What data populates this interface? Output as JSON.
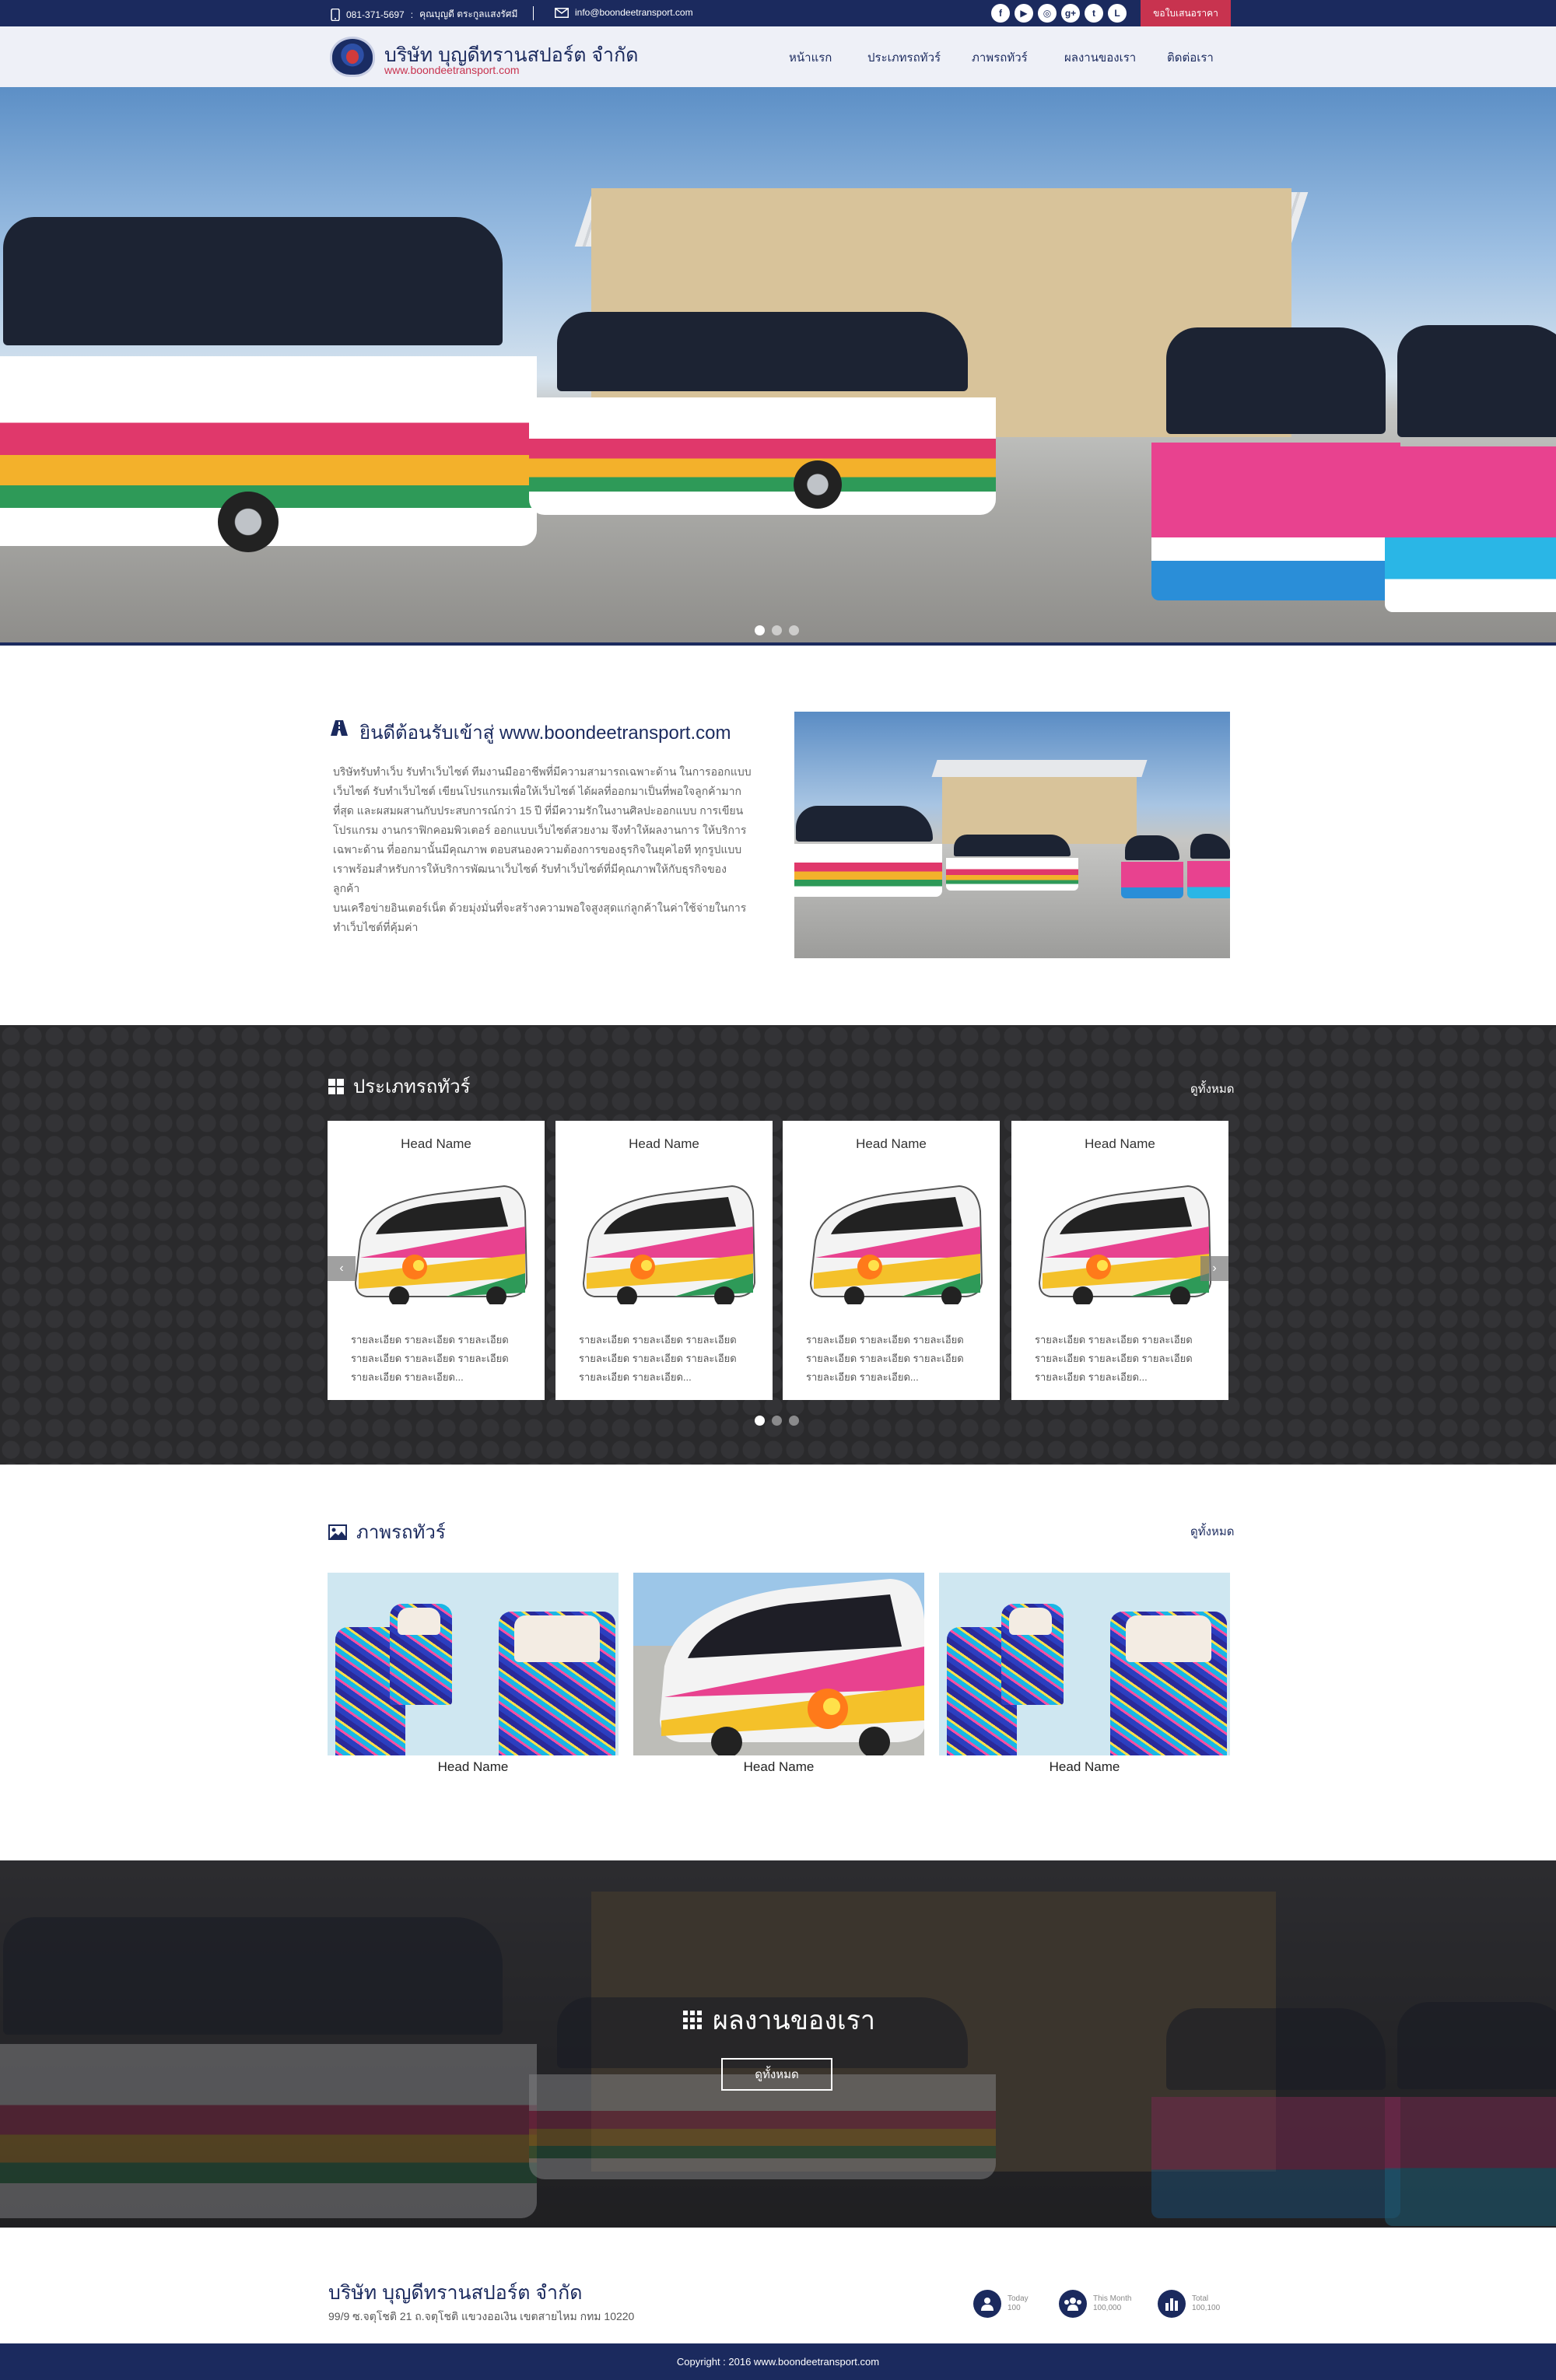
{
  "topbar": {
    "phone": "081-371-5697",
    "contact_name": "คุณบุญดี ตระกูลแสงรัศมี",
    "email": "info@boondeetransport.com",
    "quote_label": "ขอใบเสนอราคา",
    "social": [
      {
        "icon": "facebook-icon",
        "glyph": "f"
      },
      {
        "icon": "youtube-icon",
        "glyph": "▶"
      },
      {
        "icon": "instagram-icon",
        "glyph": "◎"
      },
      {
        "icon": "google-plus-icon",
        "glyph": "g+"
      },
      {
        "icon": "twitter-icon",
        "glyph": "t"
      },
      {
        "icon": "line-icon",
        "glyph": "L"
      }
    ]
  },
  "header": {
    "company_name": "บริษัท บุญดีทรานสปอร์ต จำกัด",
    "website": "www.boondeetransport.com",
    "nav": [
      "หน้าแรก",
      "ประเภทรถทัวร์",
      "ภาพรถทัวร์",
      "ผลงานของเรา",
      "ติดต่อเรา"
    ]
  },
  "hero": {
    "slides": 3,
    "active_slide": 1
  },
  "welcome": {
    "title": "ยินดีต้อนรับเข้าสู่ www.boondeetransport.com",
    "lines": [
      "บริษัทรับทำเว็บ รับทำเว็บไซต์ ทีมงานมืออาชีพที่มีความสามารถเฉพาะด้าน ในการออกแบบ",
      "เว็บไซต์ รับทำเว็บไซต์ เขียนโปรแกรมเพื่อให้เว็บไซต์ ได้ผลที่ออกมาเป็นที่พอใจลูกค้ามาก",
      "ที่สุด และผสมผสานกับประสบการณ์กว่า 15 ปี ที่มีความรักในงานศิลปะออกแบบ การเขียน",
      "โปรแกรม งานกราฟิกคอมพิวเตอร์ ออกแบบเว็บไซต์สวยงาม จึงทำให้ผลงานการ ให้บริการ",
      "เฉพาะด้าน ที่ออกมานั้นมีคุณภาพ ตอบสนองความต้องการของธุรกิจในยุคไอที ทุกรูปแบบ",
      "เราพร้อมสำหรับการให้บริการพัฒนาเว็บไซต์ รับทำเว็บไซต์ที่มีคุณภาพให้กับธุรกิจของลูกค้า",
      "บนเครือข่ายอินเตอร์เน็ต ด้วยมุ่งมั่นที่จะสร้างความพอใจสูงสุดแก่ลูกค้าในค่าใช้จ่ายในการ",
      "ทำเว็บไซต์ที่คุ้มค่า"
    ]
  },
  "tour_types": {
    "title": "ประเภทรถทัวร์",
    "see_all": "ดูทั้งหมด",
    "cards": [
      {
        "title": "Head Name",
        "desc": "รายละเอียด รายละเอียด รายละเอียด รายละเอียด รายละเอียด รายละเอียด รายละเอียด รายละเอียด..."
      },
      {
        "title": "Head Name",
        "desc": "รายละเอียด รายละเอียด รายละเอียด รายละเอียด รายละเอียด รายละเอียด รายละเอียด รายละเอียด..."
      },
      {
        "title": "Head Name",
        "desc": "รายละเอียด รายละเอียด รายละเอียด รายละเอียด รายละเอียด รายละเอียด รายละเอียด รายละเอียด..."
      },
      {
        "title": "Head Name",
        "desc": "รายละเอียด รายละเอียด รายละเอียด รายละเอียด รายละเอียด รายละเอียด รายละเอียด รายละเอียด..."
      }
    ],
    "prev_arrow": "‹",
    "next_arrow": "›",
    "slides": 3,
    "active_slide": 1
  },
  "gallery": {
    "title": "ภาพรถทัวร์",
    "see_all": "ดูทั้งหมด",
    "items": [
      {
        "caption": "Head Name"
      },
      {
        "caption": "Head Name"
      },
      {
        "caption": "Head Name"
      }
    ]
  },
  "works": {
    "title": "ผลงานของเรา",
    "button": "ดูทั้งหมด"
  },
  "footer": {
    "company_name": "บริษัท บุญดีทรานสปอร์ต จำกัด",
    "address": "99/9 ซ.จตุโชติ 21 ถ.จตุโชติ แขวงออเงิน เขตสายไหม กทม 10220",
    "stats": [
      {
        "icon": "user-icon",
        "label": "Today",
        "value": "100"
      },
      {
        "icon": "users-icon",
        "label": "This Month",
        "value": "100,000"
      },
      {
        "icon": "bar-chart-icon",
        "label": "Total",
        "value": "100,100"
      }
    ],
    "copyright": "Copyright : 2016 www.boondeetransport.com"
  },
  "colors": {
    "navy": "#1b2a5e",
    "accent": "#c8334f",
    "dark_band": "#2a2a2c"
  }
}
